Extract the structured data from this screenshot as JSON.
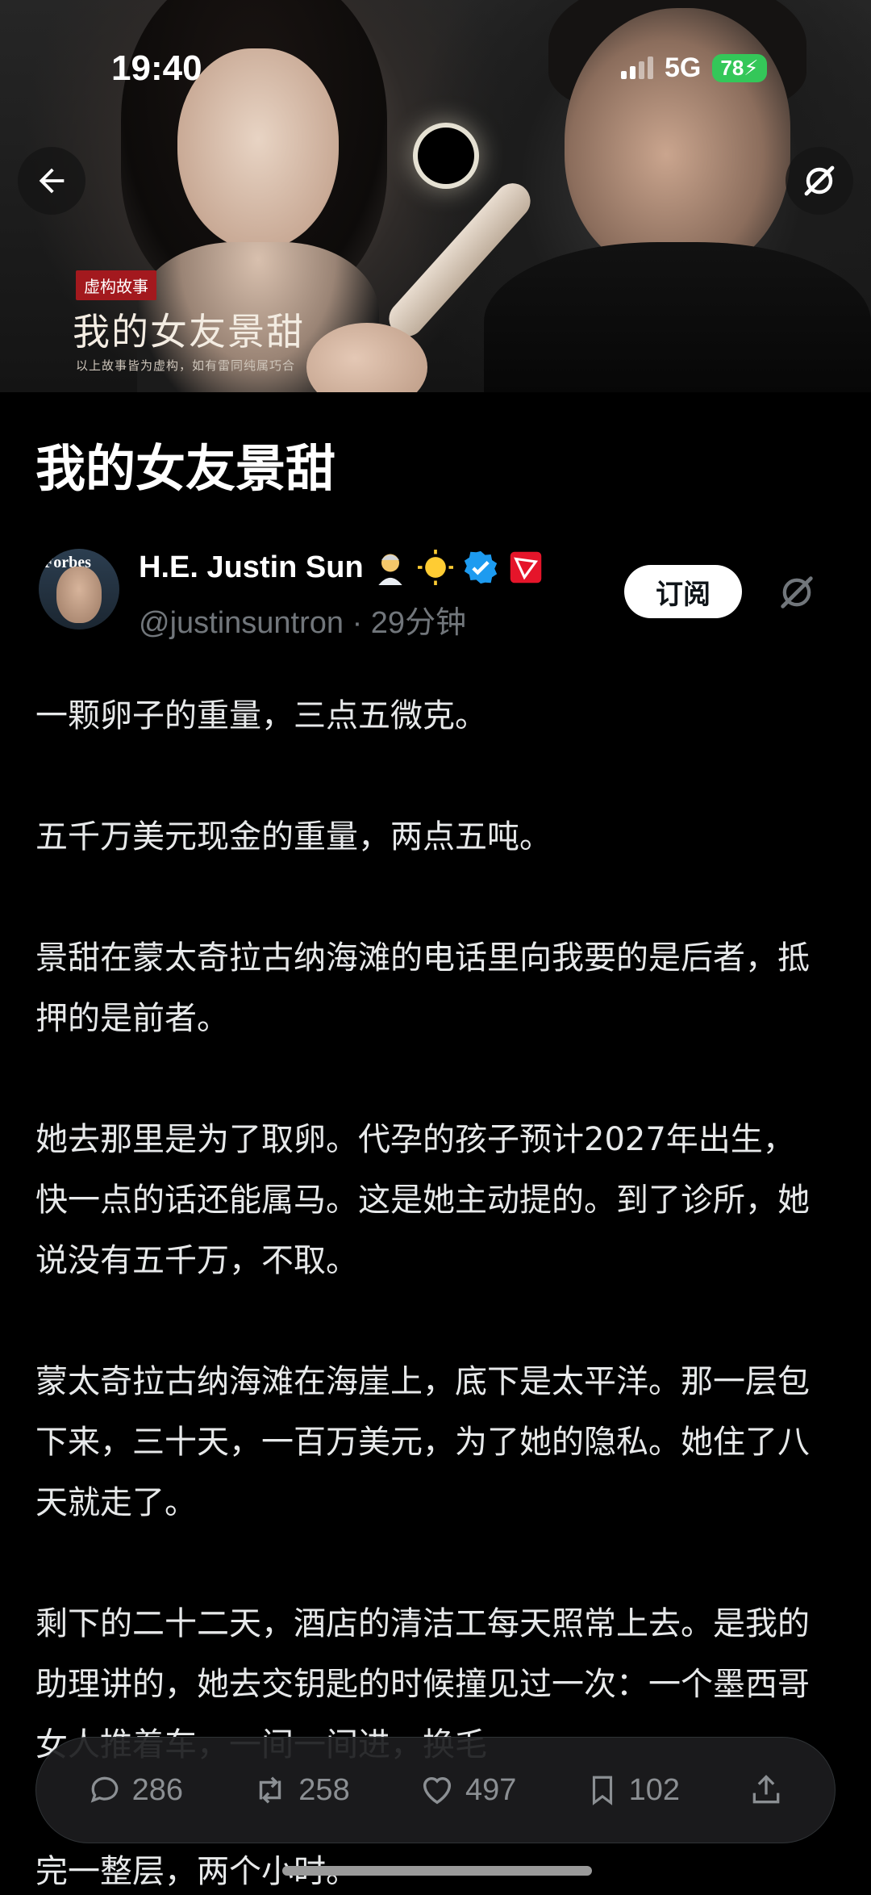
{
  "status_bar": {
    "time": "19:40",
    "network": "5G",
    "battery": "78"
  },
  "cover": {
    "tag": "虚构故事",
    "title": "我的女友景甜",
    "subtitle": "以上故事皆为虚构，如有雷同纯属巧合"
  },
  "article": {
    "title": "我的女友景甜",
    "author": {
      "name": "H.E. Justin Sun",
      "handle": "@justinsuntron · 29分钟",
      "avatar_text": "Forbes"
    },
    "subscribe_label": "订阅",
    "paragraphs": [
      "一颗卵子的重量，三点五微克。",
      "五千万美元现金的重量，两点五吨。",
      "景甜在蒙太奇拉古纳海滩的电话里向我要的是后者，抵押的是前者。",
      "她去那里是为了取卵。代孕的孩子预计2027年出生，快一点的话还能属马。这是她主动提的。到了诊所，她说没有五千万，不取。",
      "蒙太奇拉古纳海滩在海崖上，底下是太平洋。那一层包下来，三十天，一百万美元，为了她的隐私。她住了八天就走了。",
      "剩下的二十二天，酒店的清洁工每天照常上去。是我的助理讲的，她去交钥匙的时候撞见过一次：一个墨西哥女人推着车，一间一间进，换毛"
    ],
    "trailing_line": "完一整层，两个小时。"
  },
  "actions": {
    "replies": "286",
    "reposts": "258",
    "likes": "497",
    "bookmarks": "102"
  },
  "icons": [
    "back-arrow-icon",
    "grok-icon",
    "verified-icon",
    "tron-icon",
    "reply-icon",
    "repost-icon",
    "like-icon",
    "bookmark-icon",
    "share-icon"
  ]
}
